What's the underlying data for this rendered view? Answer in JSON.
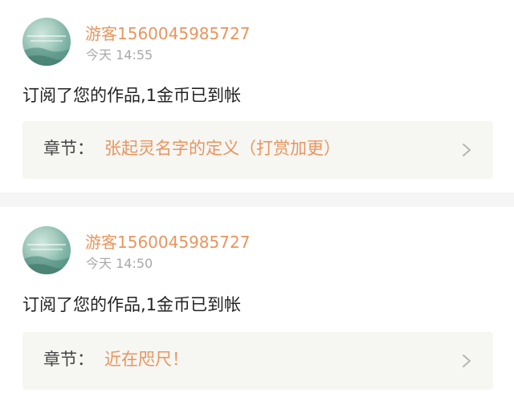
{
  "colors": {
    "accent": "#e8955e",
    "text": "#222222",
    "muted": "#a8a8a8",
    "chapter_bg": "#f6f6f2",
    "separator": "#f5f5f5"
  },
  "notifications": [
    {
      "username": "游客1560045985727",
      "time": "今天 14:55",
      "message": "订阅了您的作品,1金币已到帐",
      "chapter_prefix": "章节：",
      "chapter_title": "张起灵名字的定义（打赏加更）",
      "icon": "chevron-right-icon"
    },
    {
      "username": "游客1560045985727",
      "time": "今天 14:50",
      "message": "订阅了您的作品,1金币已到帐",
      "chapter_prefix": "章节：",
      "chapter_title": "近在咫尺！",
      "icon": "chevron-right-icon"
    }
  ]
}
